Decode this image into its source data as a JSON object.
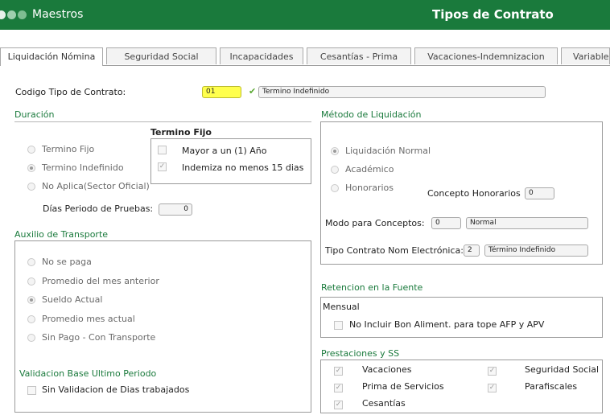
{
  "header": {
    "app_title": "Maestros",
    "screen_title": "Tipos de Contrato"
  },
  "tabs": [
    {
      "label": "Liquidación Nómina",
      "active": true
    },
    {
      "label": "Seguridad Social"
    },
    {
      "label": "Incapacidades"
    },
    {
      "label": "Cesantías - Prima"
    },
    {
      "label": "Vacaciones-Indemnizacion"
    },
    {
      "label": "Variables"
    }
  ],
  "codigo": {
    "label": "Codigo Tipo de Contrato:",
    "value": "01",
    "description": "Termino Indefinido"
  },
  "duracion": {
    "title": "Duración",
    "options": [
      {
        "label": "Termino Fijo",
        "selected": false
      },
      {
        "label": "Termino Indefinido",
        "selected": true
      },
      {
        "label": "No Aplica(Sector Oficial)",
        "selected": false
      }
    ],
    "termino_fijo": {
      "title": "Termino Fijo",
      "checks": [
        {
          "label": "Mayor a un (1) Año",
          "checked": false
        },
        {
          "label": "Indemiza no menos 15 dias",
          "checked": true
        }
      ]
    },
    "dias_prueba": {
      "label": "Días Periodo de Pruebas:",
      "value": "0"
    }
  },
  "auxilio": {
    "title": "Auxilio de Transporte",
    "options": [
      {
        "label": "No se paga",
        "selected": false
      },
      {
        "label": "Promedio del mes anterior",
        "selected": false
      },
      {
        "label": "Sueldo Actual",
        "selected": true
      },
      {
        "label": "Promedio mes actual",
        "selected": false
      },
      {
        "label": "Sin Pago - Con Transporte",
        "selected": false
      }
    ],
    "validacion_title": "Validacion Base Ultimo Periodo",
    "validacion_check": {
      "label": "Sin Validacion de Dias trabajados",
      "checked": false
    }
  },
  "metodo": {
    "title": "Método de Liquidación",
    "options": [
      {
        "label": "Liquidación Normal",
        "selected": true
      },
      {
        "label": "Académico",
        "selected": false
      },
      {
        "label": "Honorarios",
        "selected": false
      }
    ],
    "concepto_honorarios": {
      "label": "Concepto Honorarios",
      "value": "0"
    },
    "modo_conceptos": {
      "label": "Modo para Conceptos:",
      "code": "0",
      "description": "Normal"
    },
    "tipo_contrato_ne": {
      "label": "Tipo Contrato Nom Electrónica:",
      "code": "2",
      "description": "Término Indefinido"
    }
  },
  "retencion": {
    "title": "Retencion en la Fuente",
    "mensual_label": "Mensual",
    "check": {
      "label": "No Incluir Bon Aliment. para tope AFP y APV",
      "checked": false
    }
  },
  "prestaciones": {
    "title": "Prestaciones y SS",
    "items": [
      {
        "label": "Vacaciones",
        "checked": true
      },
      {
        "label": "Prima de Servicios",
        "checked": true
      },
      {
        "label": "Cesantías",
        "checked": true
      },
      {
        "label": "Seguridad Social",
        "checked": true
      },
      {
        "label": "Parafiscales",
        "checked": true
      }
    ]
  }
}
